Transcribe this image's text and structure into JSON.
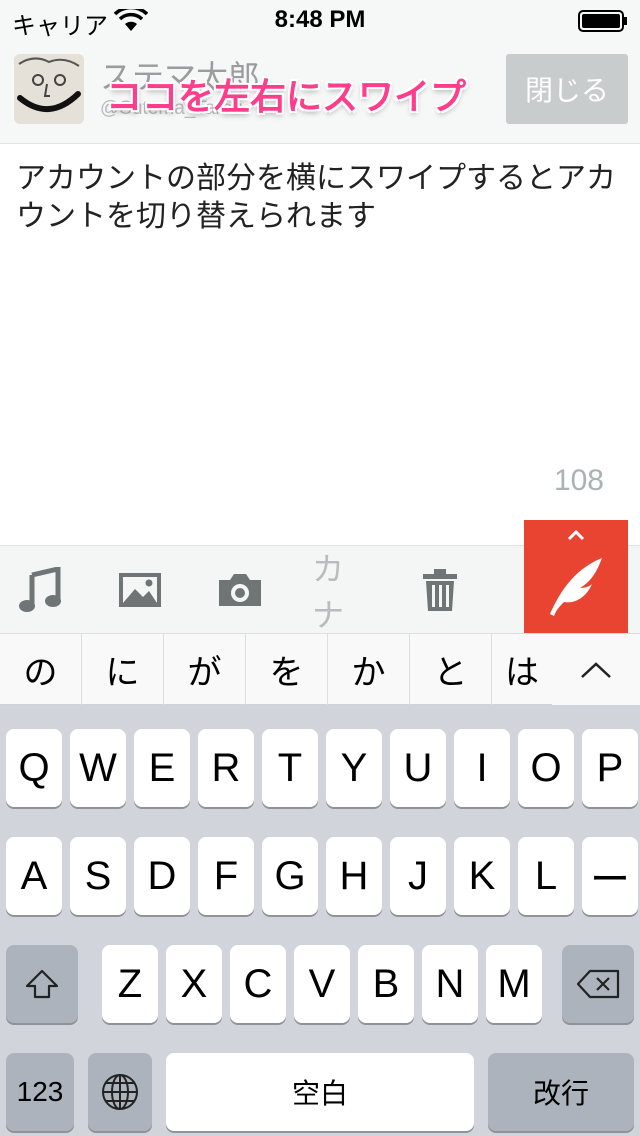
{
  "status_bar": {
    "carrier": "キャリア",
    "time": "8:48 PM"
  },
  "header": {
    "account_name": "ステマ太郎",
    "account_handle": "@Sutema_Tarou",
    "annotation": "ココを左右にスワイプ",
    "close_label": "閉じる"
  },
  "compose": {
    "text": "アカウントの部分を横にスワイプするとアカウントを切り替えられます",
    "char_count": "108"
  },
  "toolbar": {
    "icons": [
      "music-note-icon",
      "image-icon",
      "camera-icon",
      "kana-icon",
      "trash-icon",
      "quill-icon"
    ],
    "kana_label": "カナ",
    "accent_color": "#e94432"
  },
  "candidates": {
    "items": [
      "の",
      "に",
      "が",
      "を",
      "か",
      "と",
      "は"
    ]
  },
  "keyboard": {
    "row1": [
      "Q",
      "W",
      "E",
      "R",
      "T",
      "Y",
      "U",
      "I",
      "O",
      "P"
    ],
    "row2": [
      "A",
      "S",
      "D",
      "F",
      "G",
      "H",
      "J",
      "K",
      "L",
      "ー"
    ],
    "row3": [
      "Z",
      "X",
      "C",
      "V",
      "B",
      "N",
      "M"
    ],
    "numbers_label": "123",
    "space_label": "空白",
    "return_label": "改行"
  }
}
